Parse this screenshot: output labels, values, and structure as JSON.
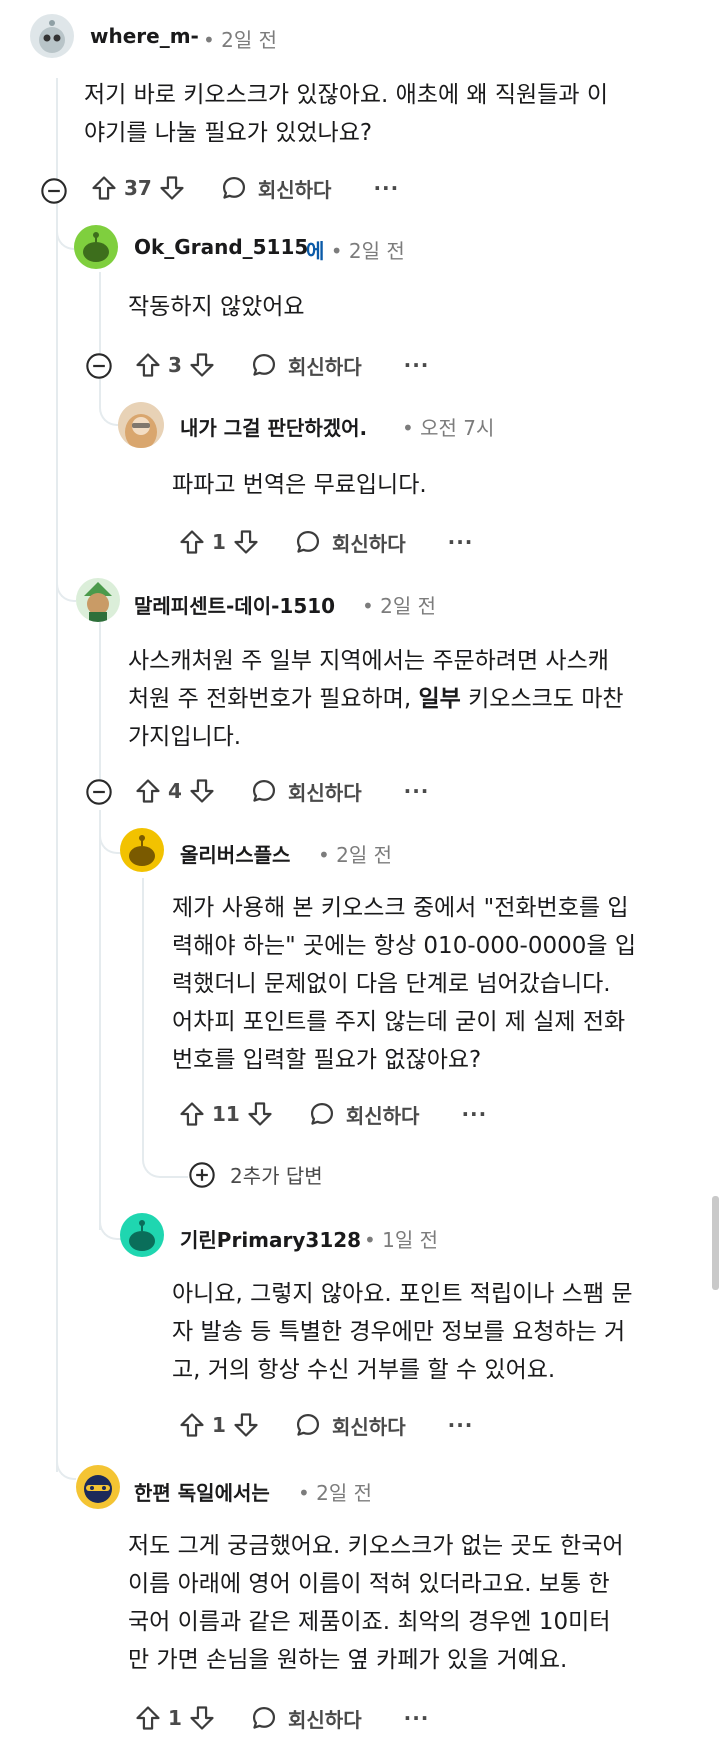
{
  "labels": {
    "reply": "회신하다",
    "more": "···"
  },
  "comments": [
    {
      "author": "where_m-",
      "flair": "",
      "time": "• 2일 전",
      "body": "저기 바로 키오스크가 있잖아요. 애초에 왜 직원들과 이\n야기를 나눌 필요가 있었나요?",
      "votes": "37",
      "avatar_color": "#b8c4c8"
    },
    {
      "author": "Ok_Grand_5115",
      "flair": "에",
      "time": "• 2일 전",
      "body": "작동하지 않았어요",
      "votes": "3",
      "avatar_color": "#7fcf3e"
    },
    {
      "author": "내가 그걸 판단하겠어.",
      "flair": "",
      "time": "• 오전 7시",
      "body": "파파고 번역은 무료입니다.",
      "votes": "1",
      "avatar_color": "#d9a66e"
    },
    {
      "author": "말레피센트-데이-1510",
      "flair": "",
      "time": "• 2일 전",
      "body_a": "사스캐처원 주 일부 지역에서는 주문하려면 사스캐\n처원 주 전화번호가 필요하며, ",
      "body_bold": "일부",
      "body_b": " 키오스크도 마찬\n가지입니다.",
      "votes": "4",
      "avatar_color": "#4b9a4b"
    },
    {
      "author": "올리버스플스",
      "flair": "",
      "time": "• 2일 전",
      "body": "제가 사용해 본 키오스크 중에서 \"전화번호를 입\n력해야 하는\" 곳에는 항상 010-000-0000을 입\n력했더니 문제없이 다음 단계로 넘어갔습니다.\n어차피 포인트를 주지 않는데 굳이 제 실제 전화\n번호를 입력할 필요가 없잖아요?",
      "votes": "11",
      "avatar_color": "#f2c200"
    },
    {
      "author": "기린Primary3128",
      "flair": "",
      "time": "• 1일 전",
      "body": "아니요, 그렇지 않아요. 포인트 적립이나 스팸 문\n자 발송 등 특별한 경우에만 정보를 요청하는 거\n고, 거의 항상 수신 거부를 할 수 있어요.",
      "votes": "1",
      "avatar_color": "#1fd6b0"
    },
    {
      "author": "한편 독일에서는",
      "flair": "",
      "time": "• 2일 전",
      "body": "저도 그게 궁금했어요. 키오스크가 없는 곳도 한국어\n이름 아래에 영어 이름이 적혀 있더라고요. 보통 한\n국어 이름과 같은 제품이죠. 최악의 경우엔 10미터\n만 가면 손님을 원하는 옆 카페가 있을 거예요.",
      "votes": "1",
      "avatar_color": "#1c2a5a"
    }
  ],
  "more_replies": "2추가 답변"
}
